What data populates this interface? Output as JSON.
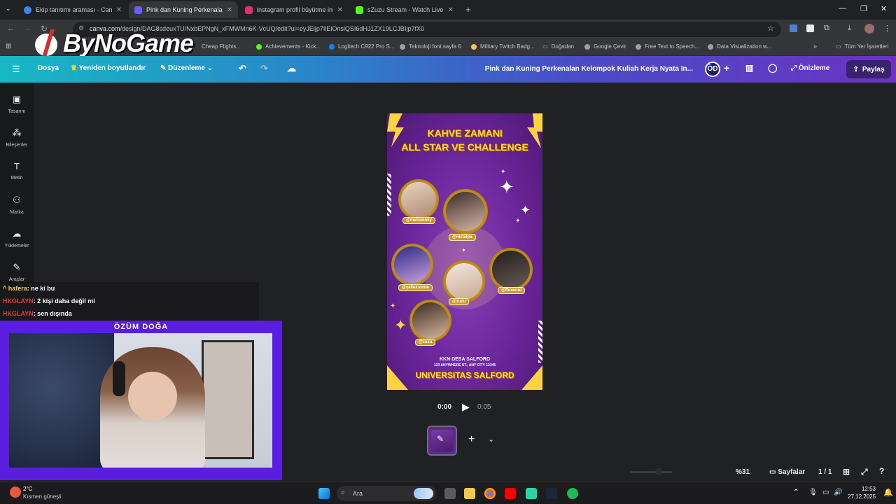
{
  "tabs": [
    {
      "title": "Ekip tanıtımı araması - Canva",
      "color": "#3b82f6"
    },
    {
      "title": "Pink dan Kuning Perkenalan Ke",
      "color": "#6a5cff"
    },
    {
      "title": "instagram profil büyütme insta",
      "color": "#e1306c"
    },
    {
      "title": "sZuzu Stream - Watch Live on",
      "color": "#53fc18"
    }
  ],
  "address": {
    "host": "canva.com",
    "path": "/design/DAG8sdeuxTU/NxbEPNgN_xFMWMn6K-VcUQ/edit?ui=eyJEljp7IlEiOnsiQSI6dHJ1ZX19LCJBIjp7fX0"
  },
  "bookmarks": [
    "Cheap Flights...",
    "Achievements - Kick...",
    "Logitech C922 Pro S...",
    "Teknoloji font sayfa 6",
    "Military Twitch Badg...",
    "Doğadan",
    "Google Çevir",
    "Free Text to Speech...",
    "Data Visualization w...",
    "Tüm Yer İşaretleri"
  ],
  "logo": {
    "text": "ByNoGame"
  },
  "canva": {
    "file": "Dosya",
    "resize": "Yeniden boyutlandır",
    "edit": "Düzenleme",
    "title": "Pink dan Kuning Perkenalan Kelompok Kuliah Kerja Nyata In...",
    "avatar": "ÖD",
    "preview": "Önizleme",
    "share": "Paylaş"
  },
  "sidebar": [
    "Tasarım",
    "Bileşenler",
    "Metin",
    "Marka",
    "Yüklemeler",
    "Araçlar"
  ],
  "poster": {
    "title1": "KAHVE ZAMANI",
    "title2": "ALL STAR VE CHALLENGE",
    "handles": [
      "@melismoky",
      "@nictalpa",
      "@yelluxstone",
      "@zuzu",
      "@fhoexnd",
      "@zuzu"
    ],
    "foot1": "KKN DESA SALFORD",
    "foot2": "123 ANYWHERE ST., ANY CITY 12345",
    "foot3": "UNIVERSITAS SALFORD"
  },
  "playback": {
    "current": "0:00",
    "duration": "0:05"
  },
  "bottom": {
    "zoom": "%31",
    "pages_label": "Sayfalar",
    "pages": "1 / 1"
  },
  "chat": [
    {
      "user": "hafera",
      "msg": ": ne ki bu"
    },
    {
      "user": "HKGLAYN",
      "msg": ": 2 kişi daha değil mi"
    },
    {
      "user": "HKGLAYN",
      "msg": ": sen dışında"
    }
  ],
  "cam": {
    "name": "ÖZÜM DOĞA"
  },
  "taskbar": {
    "weather_temp": "2°C",
    "weather_desc": "Kısmen güneşli",
    "search": "Ara",
    "time": "12:53",
    "date": "27.12.2025"
  }
}
